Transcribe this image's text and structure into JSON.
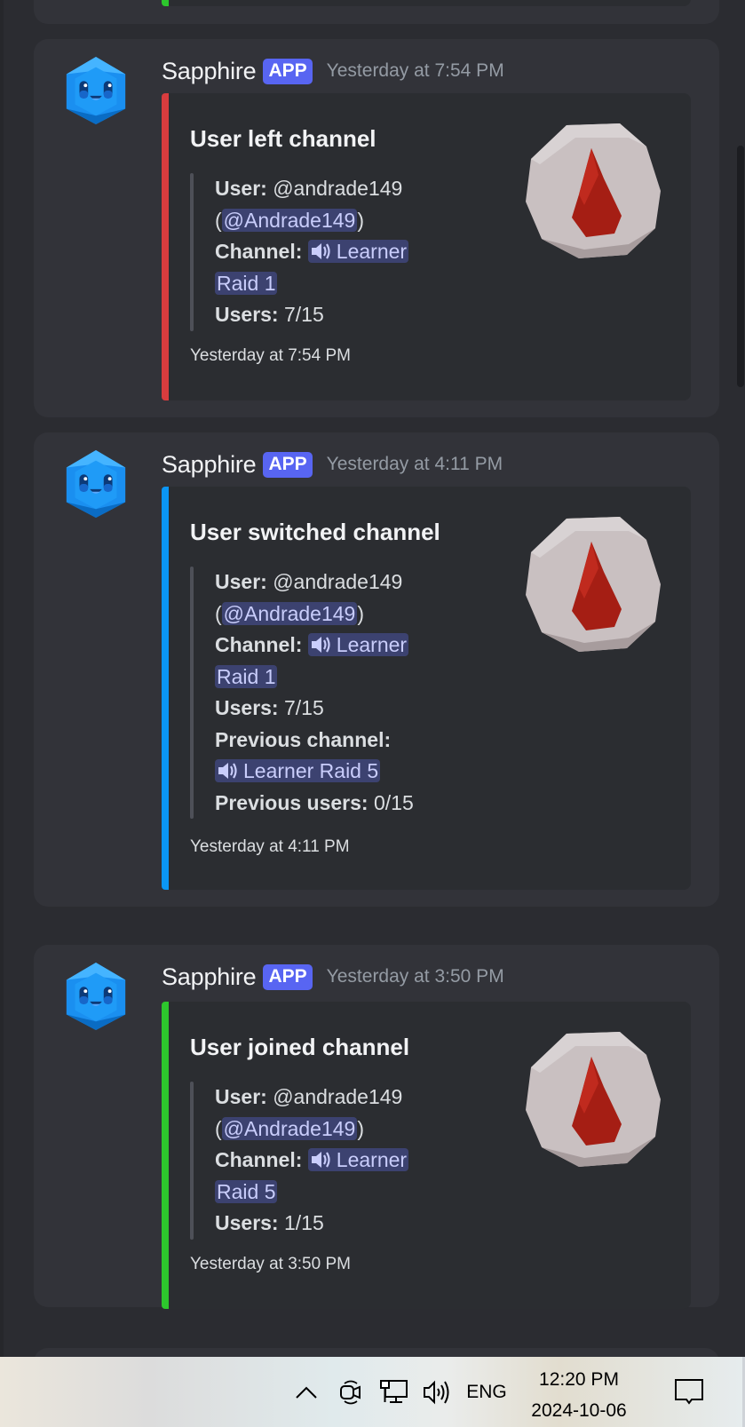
{
  "messages": [
    {
      "author": "Sapphire",
      "badge": "APP",
      "timestamp": "Yesterday at 7:54 PM",
      "embed": {
        "color": "#d83c3e",
        "title": "User left channel",
        "user_label": "User:",
        "user_value": "@andrade149",
        "user_mention": "@Andrade149",
        "channel_label": "Channel:",
        "channel_line1": "Learner",
        "channel_line2": "Raid 1",
        "users_label": "Users:",
        "users_value": "7/15",
        "footer": "Yesterday at 7:54 PM",
        "thumbnail": "blood-rune-icon"
      }
    },
    {
      "author": "Sapphire",
      "badge": "APP",
      "timestamp": "Yesterday at 4:11 PM",
      "embed": {
        "color": "#0b96f5",
        "title": "User switched channel",
        "user_label": "User:",
        "user_value": "@andrade149",
        "user_mention": "@Andrade149",
        "channel_label": "Channel:",
        "channel_line1": "Learner",
        "channel_line2": "Raid 1",
        "users_label": "Users:",
        "users_value": "7/15",
        "prev_channel_label": "Previous channel:",
        "prev_channel": "Learner Raid 5",
        "prev_users_label": "Previous users:",
        "prev_users_value": "0/15",
        "footer": "Yesterday at 4:11 PM",
        "thumbnail": "blood-rune-icon"
      }
    },
    {
      "author": "Sapphire",
      "badge": "APP",
      "timestamp": "Yesterday at 3:50 PM",
      "embed": {
        "color": "#2dc72d",
        "title": "User joined channel",
        "user_label": "User:",
        "user_value": "@andrade149",
        "user_mention": "@Andrade149",
        "channel_label": "Channel:",
        "channel_line1": "Learner",
        "channel_line2": "Raid 5",
        "users_label": "Users:",
        "users_value": "1/15",
        "footer": "Yesterday at 3:50 PM",
        "thumbnail": "blood-rune-icon"
      }
    }
  ],
  "taskbar": {
    "tray_icons": [
      "chevron-up-icon",
      "meet-now-icon",
      "network-icon",
      "volume-icon"
    ],
    "language": "ENG",
    "time": "12:20 PM",
    "date": "2024-10-06",
    "notification_icon": "action-center-icon"
  }
}
